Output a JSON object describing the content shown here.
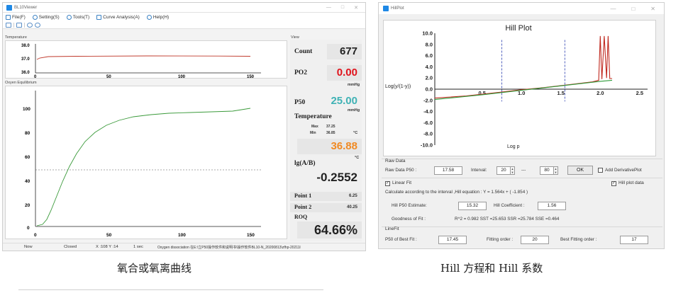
{
  "left_window": {
    "title": "BL10Viewer",
    "menu": [
      "File(F)",
      "Setting(S)",
      "Tools(T)",
      "Curve Analysis(A)",
      "Help(H)"
    ],
    "temp_panel_label": "Temperature",
    "oxy_panel_label": "Oxyen Equilibrium",
    "view_label": "View",
    "temp_yticks": [
      "38.0",
      "37.0",
      "36.0"
    ],
    "temp_xticks": [
      "0",
      "50",
      "100",
      "150"
    ],
    "oxy_yticks": [
      "100",
      "80",
      "60",
      "40",
      "20",
      "0"
    ],
    "oxy_xticks": [
      "0",
      "50",
      "100",
      "150"
    ],
    "view": {
      "count_label": "Count",
      "count_value": "677",
      "po2_label": "PO2",
      "po2_value": "0.00",
      "po2_unit": "mmHg",
      "p50_label": "P50",
      "p50_value": "25.00",
      "p50_unit": "mmHg",
      "temperature_label": "Temperature",
      "max_label": "Max",
      "max_value": "37.25",
      "min_label": "Min",
      "min_value": "36.85",
      "temp_unit": "°C",
      "temp_value": "36.88",
      "temp_value_unit": "°C",
      "lgab_label": "lg(A/B)",
      "lgab_value": "-0.2552",
      "point1_label": "Point 1",
      "point1_value": "6.25",
      "point2_label": "Point 2",
      "point2_value": "40.25",
      "roq_label": "ROQ",
      "roq_value": "64.66%"
    },
    "status": {
      "now": "Now",
      "state": "Closed",
      "xy": "X :108  Y :14",
      "interval": "1 sec",
      "path": "Oxygen dissociation 在E:\\立P50操作软件和说明书\\操作软件BL10-N_20200813\\zfhp-20211l"
    },
    "colors": {
      "p50_value": "#3fb2b5",
      "po2_value": "#e0121b",
      "temp_value": "#f08a24",
      "temp_line": "#c0392b",
      "oxy_line": "#3a9a3a"
    }
  },
  "right_window": {
    "title": "HillPlot",
    "chart_data": {
      "type": "line",
      "title": "Hill Plot",
      "xlabel": "Log p",
      "ylabel": "Log(y/(1-y))",
      "xticks": [
        "0.5",
        "1.0",
        "1.5",
        "2.0",
        "2.5"
      ],
      "yticks": [
        "10.0",
        "8.0",
        "6.0",
        "4.0",
        "2.0",
        "0.0",
        "-2.0",
        "-4.0",
        "-6.0",
        "-8.0",
        "-10.0"
      ],
      "xlim": [
        -0.1,
        2.6
      ],
      "ylim": [
        -10,
        10
      ],
      "vlines": [
        0.75,
        1.55
      ],
      "series": [
        {
          "color": "#c0281e",
          "x": [
            -0.1,
            0.3,
            0.7,
            1.0,
            1.3,
            1.6,
            1.9,
            1.98,
            2.0,
            2.02,
            2.05,
            2.08,
            2.1,
            2.12,
            2.15
          ],
          "y": [
            -1.6,
            -1.2,
            -0.6,
            -0.1,
            0.3,
            0.8,
            1.3,
            1.6,
            9.5,
            1.8,
            9.5,
            2.0,
            9.5,
            1.9,
            1.9
          ]
        },
        {
          "color": "#2e9a3a",
          "x": [
            -0.1,
            0.5,
            1.0,
            1.5,
            2.0,
            2.15
          ],
          "y": [
            -1.85,
            -1.0,
            -0.2,
            0.6,
            1.4,
            1.6
          ]
        }
      ]
    },
    "raw_data": {
      "group_label": "Raw Data",
      "p50_label": "Raw Data P50 :",
      "p50_value": "17.58",
      "interval_label": "Interval:",
      "interval_from": "20",
      "interval_sep": "---",
      "interval_to": "80",
      "ok_label": "OK",
      "derivative_label": "Add DerivativePlot"
    },
    "linear_fit": {
      "label": "Linear Fit",
      "checked": true,
      "hill_plot_data_label": "Hill plot data",
      "equation_text": "Calculate according to the interval ,Hill equation :    Y = 1.564x +  ( -1.854 )",
      "p50_estimate_label": "Hill P50 Estimate:",
      "p50_estimate_value": "15.32",
      "coef_label": "Hill Coefficient :",
      "coef_value": "1.56",
      "goodness_label": "Goodness of Fit :",
      "goodness_value": "R^2 =  0.982 SST =25.653 SSR =25.784 SSE =0.464"
    },
    "line_fit": {
      "group_label": "LineFit",
      "p50_best_label": "P50 of Best Fit :",
      "p50_best_value": "17.45",
      "order_label": "Fitting order :",
      "order_value": "20",
      "best_order_label": "Best Fitting order :",
      "best_order_value": "17"
    }
  },
  "captions": {
    "left": "氧合或氧离曲线",
    "right": "Hill 方程和 Hill 系数"
  }
}
